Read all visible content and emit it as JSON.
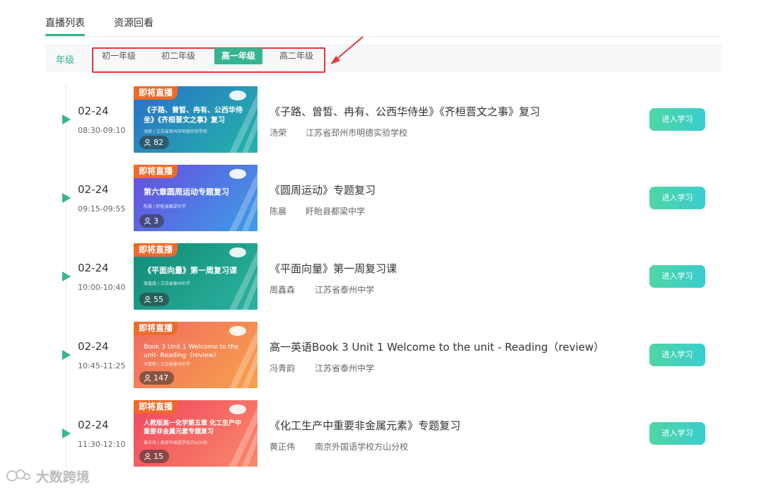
{
  "tabs": [
    {
      "label": "直播列表",
      "active": true
    },
    {
      "label": "资源回看",
      "active": false
    }
  ],
  "grade_filter": {
    "label": "年级",
    "options": [
      {
        "label": "初一年级",
        "active": false
      },
      {
        "label": "初二年级",
        "active": false
      },
      {
        "label": "高一年级",
        "active": true
      },
      {
        "label": "高二年级",
        "active": false
      }
    ]
  },
  "colors": {
    "accent": "#36b592",
    "highlight_box": "#e03a3a",
    "badge": "#ef6a2a"
  },
  "lessons": [
    {
      "date": "02-24",
      "time": "08:30-09:10",
      "thumb_badge": "即将直播",
      "thumb_text": "《子路、曾皙、冉有、公西华侍坐》《齐桓晋文之事》复习",
      "thumb_sub": "汤荣 | 江苏省邳州市明德实验学校",
      "viewers": "82",
      "title": "《子路、曾皙、冉有、公西华侍坐》《齐桓晋文之事》复习",
      "teacher": "汤荣",
      "school": "江苏省邳州市明德实验学校",
      "button": "进入学习"
    },
    {
      "date": "02-24",
      "time": "09:15-09:55",
      "thumb_badge": "即将直播",
      "thumb_text": "第六章圆周运动专题复习",
      "thumb_sub": "陈晨 | 盱眙县都梁中学",
      "viewers": "3",
      "title": "《圆周运动》专题复习",
      "teacher": "陈晨",
      "school": "盱眙县都梁中学",
      "button": "进入学习"
    },
    {
      "date": "02-24",
      "time": "10:00-10:40",
      "thumb_badge": "即将直播",
      "thumb_text": "《平面向量》第一周复习课",
      "thumb_sub": "周鑫森 | 江苏省泰州中学",
      "viewers": "55",
      "title": "《平面向量》第一周复习课",
      "teacher": "周鑫森",
      "school": "江苏省泰州中学",
      "button": "进入学习"
    },
    {
      "date": "02-24",
      "time": "10:45-11:25",
      "thumb_badge": "即将直播",
      "thumb_text": "Book 3 Unit 1 Welcome to the unit- Reading（review）",
      "thumb_sub": "冯青韵 | 江苏省泰州中学",
      "viewers": "147",
      "title": "高一英语Book 3 Unit 1 Welcome to the unit - Reading（review）",
      "teacher": "冯青韵",
      "school": "江苏省泰州中学",
      "button": "进入学习"
    },
    {
      "date": "02-24",
      "time": "11:30-12:10",
      "thumb_badge": "即将直播",
      "thumb_text": "人教版高一化学第五章 化工生产中重要非金属元素专题复习",
      "thumb_sub": "黄正伟 | 南京外国语学校方山分校",
      "viewers": "15",
      "title": "《化工生产中重要非金属元素》专题复习",
      "teacher": "黄正伟",
      "school": "南京外国语学校方山分校",
      "button": "进入学习"
    }
  ],
  "watermark": "大数跨境"
}
